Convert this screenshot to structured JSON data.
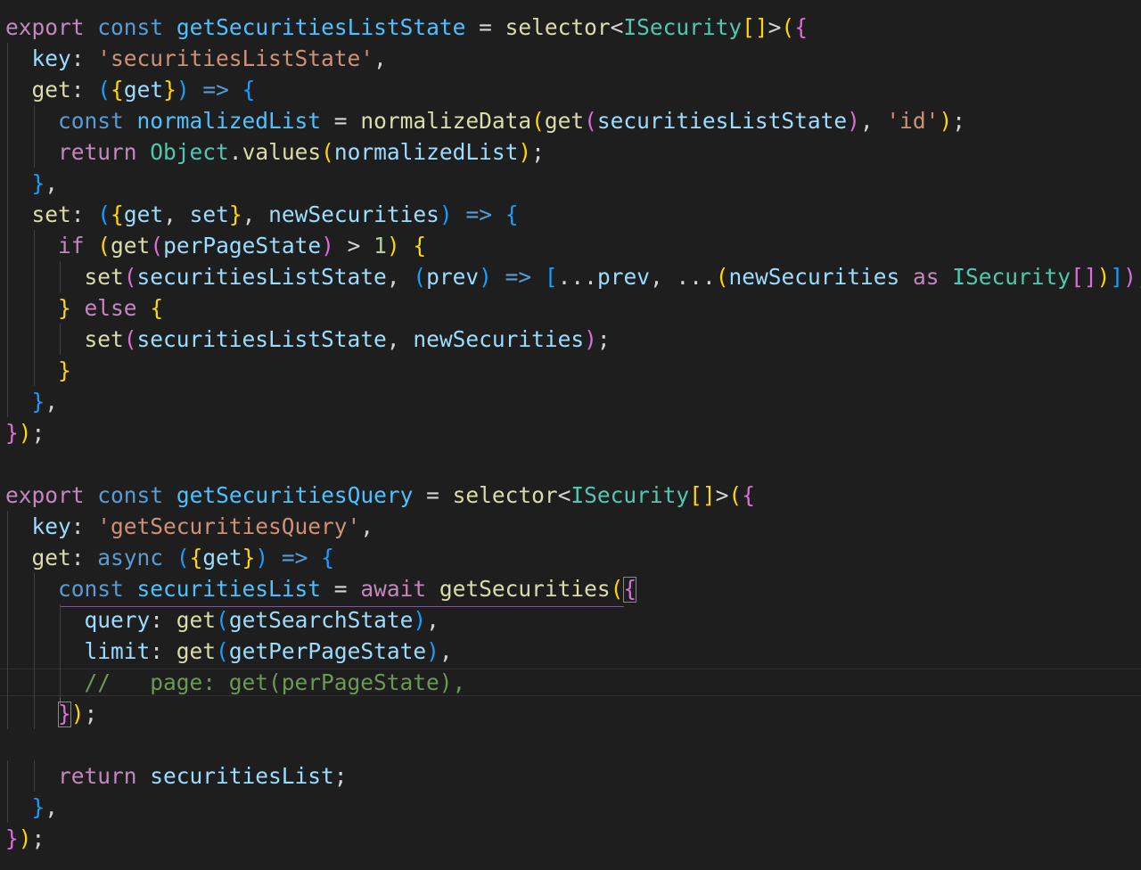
{
  "colors": {
    "background": "#1e1e1e",
    "keyword": "#c586c0",
    "storage": "#569cd6",
    "function": "#dcdcaa",
    "variable": "#9cdcfe",
    "constant": "#4fc1ff",
    "type": "#4ec9b0",
    "string": "#ce9178",
    "number": "#b5cea8",
    "comment": "#6a9955",
    "plain": "#d4d4d4",
    "bracket1": "#ffd700",
    "bracket2": "#da70d6",
    "bracket3": "#179fff"
  },
  "lines": [
    {
      "indent": 0,
      "tokens": [
        [
          "export",
          "keyword"
        ],
        [
          " ",
          "plain"
        ],
        [
          "const",
          "storage"
        ],
        [
          " ",
          "plain"
        ],
        [
          "getSecuritiesListState",
          "constant"
        ],
        [
          " = ",
          "plain"
        ],
        [
          "selector",
          "function"
        ],
        [
          "<",
          "plain"
        ],
        [
          "ISecurity",
          "type"
        ],
        [
          "[]",
          "bracket1"
        ],
        [
          ">",
          "plain"
        ],
        [
          "(",
          "bracket1"
        ],
        [
          "{",
          "bracket2"
        ]
      ]
    },
    {
      "indent": 1,
      "tokens": [
        [
          "key",
          "variable"
        ],
        [
          ": ",
          "plain"
        ],
        [
          "'securitiesListState'",
          "string"
        ],
        [
          ",",
          "plain"
        ]
      ]
    },
    {
      "indent": 1,
      "tokens": [
        [
          "get",
          "function"
        ],
        [
          ": ",
          "plain"
        ],
        [
          "(",
          "bracket3"
        ],
        [
          "{",
          "bracket1"
        ],
        [
          "get",
          "variable"
        ],
        [
          "}",
          "bracket1"
        ],
        [
          ")",
          "bracket3"
        ],
        [
          " ",
          "plain"
        ],
        [
          "=>",
          "storage"
        ],
        [
          " ",
          "plain"
        ],
        [
          "{",
          "bracket3"
        ]
      ]
    },
    {
      "indent": 2,
      "tokens": [
        [
          "const",
          "storage"
        ],
        [
          " ",
          "plain"
        ],
        [
          "normalizedList",
          "constant"
        ],
        [
          " = ",
          "plain"
        ],
        [
          "normalizeData",
          "function"
        ],
        [
          "(",
          "bracket1"
        ],
        [
          "get",
          "function"
        ],
        [
          "(",
          "bracket2"
        ],
        [
          "securitiesListState",
          "variable"
        ],
        [
          ")",
          "bracket2"
        ],
        [
          ", ",
          "plain"
        ],
        [
          "'id'",
          "string"
        ],
        [
          ")",
          "bracket1"
        ],
        [
          ";",
          "plain"
        ]
      ]
    },
    {
      "indent": 2,
      "tokens": [
        [
          "return",
          "keyword"
        ],
        [
          " ",
          "plain"
        ],
        [
          "Object",
          "type"
        ],
        [
          ".",
          "plain"
        ],
        [
          "values",
          "function"
        ],
        [
          "(",
          "bracket1"
        ],
        [
          "normalizedList",
          "variable"
        ],
        [
          ")",
          "bracket1"
        ],
        [
          ";",
          "plain"
        ]
      ]
    },
    {
      "indent": 1,
      "tokens": [
        [
          "}",
          "bracket3"
        ],
        [
          ",",
          "plain"
        ]
      ]
    },
    {
      "indent": 1,
      "tokens": [
        [
          "set",
          "function"
        ],
        [
          ": ",
          "plain"
        ],
        [
          "(",
          "bracket3"
        ],
        [
          "{",
          "bracket1"
        ],
        [
          "get",
          "variable"
        ],
        [
          ", ",
          "plain"
        ],
        [
          "set",
          "variable"
        ],
        [
          "}",
          "bracket1"
        ],
        [
          ", ",
          "plain"
        ],
        [
          "newSecurities",
          "variable"
        ],
        [
          ")",
          "bracket3"
        ],
        [
          " ",
          "plain"
        ],
        [
          "=>",
          "storage"
        ],
        [
          " ",
          "plain"
        ],
        [
          "{",
          "bracket3"
        ]
      ]
    },
    {
      "indent": 2,
      "tokens": [
        [
          "if",
          "keyword"
        ],
        [
          " ",
          "plain"
        ],
        [
          "(",
          "bracket1"
        ],
        [
          "get",
          "function"
        ],
        [
          "(",
          "bracket2"
        ],
        [
          "perPageState",
          "variable"
        ],
        [
          ")",
          "bracket2"
        ],
        [
          " > ",
          "plain"
        ],
        [
          "1",
          "number"
        ],
        [
          ")",
          "bracket1"
        ],
        [
          " ",
          "plain"
        ],
        [
          "{",
          "bracket1"
        ]
      ]
    },
    {
      "indent": 3,
      "tokens": [
        [
          "set",
          "function"
        ],
        [
          "(",
          "bracket2"
        ],
        [
          "securitiesListState",
          "variable"
        ],
        [
          ", ",
          "plain"
        ],
        [
          "(",
          "bracket3"
        ],
        [
          "prev",
          "variable"
        ],
        [
          ")",
          "bracket3"
        ],
        [
          " ",
          "plain"
        ],
        [
          "=>",
          "storage"
        ],
        [
          " ",
          "plain"
        ],
        [
          "[",
          "bracket3"
        ],
        [
          "...",
          "plain"
        ],
        [
          "prev",
          "variable"
        ],
        [
          ", ...",
          "plain"
        ],
        [
          "(",
          "bracket1"
        ],
        [
          "newSecurities",
          "variable"
        ],
        [
          " ",
          "plain"
        ],
        [
          "as",
          "keyword"
        ],
        [
          " ",
          "plain"
        ],
        [
          "ISecurity",
          "type"
        ],
        [
          "[]",
          "bracket2"
        ],
        [
          ")",
          "bracket1"
        ],
        [
          "]",
          "bracket3"
        ],
        [
          ")",
          "bracket2"
        ],
        [
          ";",
          "plain"
        ]
      ]
    },
    {
      "indent": 2,
      "tokens": [
        [
          "}",
          "bracket1"
        ],
        [
          " ",
          "plain"
        ],
        [
          "else",
          "keyword"
        ],
        [
          " ",
          "plain"
        ],
        [
          "{",
          "bracket1"
        ]
      ]
    },
    {
      "indent": 3,
      "tokens": [
        [
          "set",
          "function"
        ],
        [
          "(",
          "bracket2"
        ],
        [
          "securitiesListState",
          "variable"
        ],
        [
          ", ",
          "plain"
        ],
        [
          "newSecurities",
          "variable"
        ],
        [
          ")",
          "bracket2"
        ],
        [
          ";",
          "plain"
        ]
      ]
    },
    {
      "indent": 2,
      "tokens": [
        [
          "}",
          "bracket1"
        ]
      ]
    },
    {
      "indent": 1,
      "tokens": [
        [
          "}",
          "bracket3"
        ],
        [
          ",",
          "plain"
        ]
      ]
    },
    {
      "indent": 0,
      "tokens": [
        [
          "}",
          "bracket2"
        ],
        [
          ")",
          "bracket1"
        ],
        [
          ";",
          "plain"
        ]
      ]
    },
    {
      "indent": 0,
      "tokens": []
    },
    {
      "indent": 0,
      "tokens": [
        [
          "export",
          "keyword"
        ],
        [
          " ",
          "plain"
        ],
        [
          "const",
          "storage"
        ],
        [
          " ",
          "plain"
        ],
        [
          "getSecuritiesQuery",
          "constant"
        ],
        [
          " = ",
          "plain"
        ],
        [
          "selector",
          "function"
        ],
        [
          "<",
          "plain"
        ],
        [
          "ISecurity",
          "type"
        ],
        [
          "[]",
          "bracket1"
        ],
        [
          ">",
          "plain"
        ],
        [
          "(",
          "bracket1"
        ],
        [
          "{",
          "bracket2"
        ]
      ]
    },
    {
      "indent": 1,
      "tokens": [
        [
          "key",
          "variable"
        ],
        [
          ": ",
          "plain"
        ],
        [
          "'getSecuritiesQuery'",
          "string"
        ],
        [
          ",",
          "plain"
        ]
      ]
    },
    {
      "indent": 1,
      "tokens": [
        [
          "get",
          "function"
        ],
        [
          ": ",
          "plain"
        ],
        [
          "async",
          "storage"
        ],
        [
          " ",
          "plain"
        ],
        [
          "(",
          "bracket3"
        ],
        [
          "{",
          "bracket1"
        ],
        [
          "get",
          "variable"
        ],
        [
          "}",
          "bracket1"
        ],
        [
          ")",
          "bracket3"
        ],
        [
          " ",
          "plain"
        ],
        [
          "=>",
          "storage"
        ],
        [
          " ",
          "plain"
        ],
        [
          "{",
          "bracket3"
        ]
      ]
    },
    {
      "indent": 2,
      "tokens": [
        [
          "const",
          "storage"
        ],
        [
          " ",
          "plain"
        ],
        [
          "securitiesList",
          "constant"
        ],
        [
          " = ",
          "plain"
        ],
        [
          "await",
          "keyword"
        ],
        [
          " ",
          "plain"
        ],
        [
          "getSecurities",
          "function"
        ],
        [
          "(",
          "bracket1"
        ],
        [
          "{",
          "bracket2"
        ]
      ]
    },
    {
      "indent": 3,
      "tokens": [
        [
          "query",
          "variable"
        ],
        [
          ": ",
          "plain"
        ],
        [
          "get",
          "function"
        ],
        [
          "(",
          "bracket3"
        ],
        [
          "getSearchState",
          "variable"
        ],
        [
          ")",
          "bracket3"
        ],
        [
          ",",
          "plain"
        ]
      ]
    },
    {
      "indent": 3,
      "tokens": [
        [
          "limit",
          "variable"
        ],
        [
          ": ",
          "plain"
        ],
        [
          "get",
          "function"
        ],
        [
          "(",
          "bracket3"
        ],
        [
          "getPerPageState",
          "variable"
        ],
        [
          ")",
          "bracket3"
        ],
        [
          ",",
          "plain"
        ]
      ]
    },
    {
      "indent": 3,
      "tokens": [
        [
          "//   page: get(perPageState),",
          "comment"
        ]
      ]
    },
    {
      "indent": 2,
      "tokens": [
        [
          "}",
          "bracket2"
        ],
        [
          ")",
          "bracket1"
        ],
        [
          ";",
          "plain"
        ]
      ]
    },
    {
      "indent": 0,
      "tokens": []
    },
    {
      "indent": 2,
      "tokens": [
        [
          "return",
          "keyword"
        ],
        [
          " ",
          "plain"
        ],
        [
          "securitiesList",
          "variable"
        ],
        [
          ";",
          "plain"
        ]
      ]
    },
    {
      "indent": 1,
      "tokens": [
        [
          "}",
          "bracket3"
        ],
        [
          ",",
          "plain"
        ]
      ]
    },
    {
      "indent": 0,
      "tokens": [
        [
          "}",
          "bracket2"
        ],
        [
          ")",
          "bracket1"
        ],
        [
          ";",
          "plain"
        ]
      ]
    }
  ]
}
